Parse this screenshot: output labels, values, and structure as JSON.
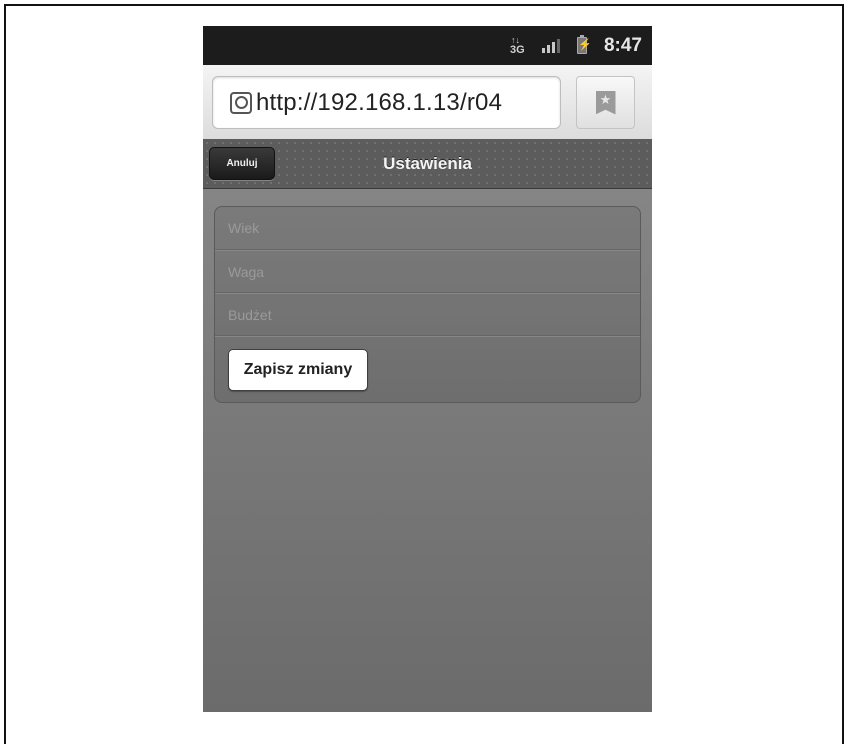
{
  "status_bar": {
    "network_type": "3G",
    "network_arrows": "↑↓",
    "time": "8:47",
    "icons": [
      "network-3g-icon",
      "signal-strength-icon",
      "battery-charging-icon"
    ]
  },
  "browser": {
    "url": "http://192.168.1.13/r04",
    "icons": [
      "globe-icon",
      "bookmark-star-icon"
    ]
  },
  "header": {
    "cancel_label": "Anuluj",
    "title": "Ustawienia"
  },
  "form": {
    "fields": [
      {
        "placeholder": "Wiek",
        "value": ""
      },
      {
        "placeholder": "Waga",
        "value": ""
      },
      {
        "placeholder": "Budżet",
        "value": ""
      }
    ],
    "save_label": "Zapisz zmiany"
  }
}
